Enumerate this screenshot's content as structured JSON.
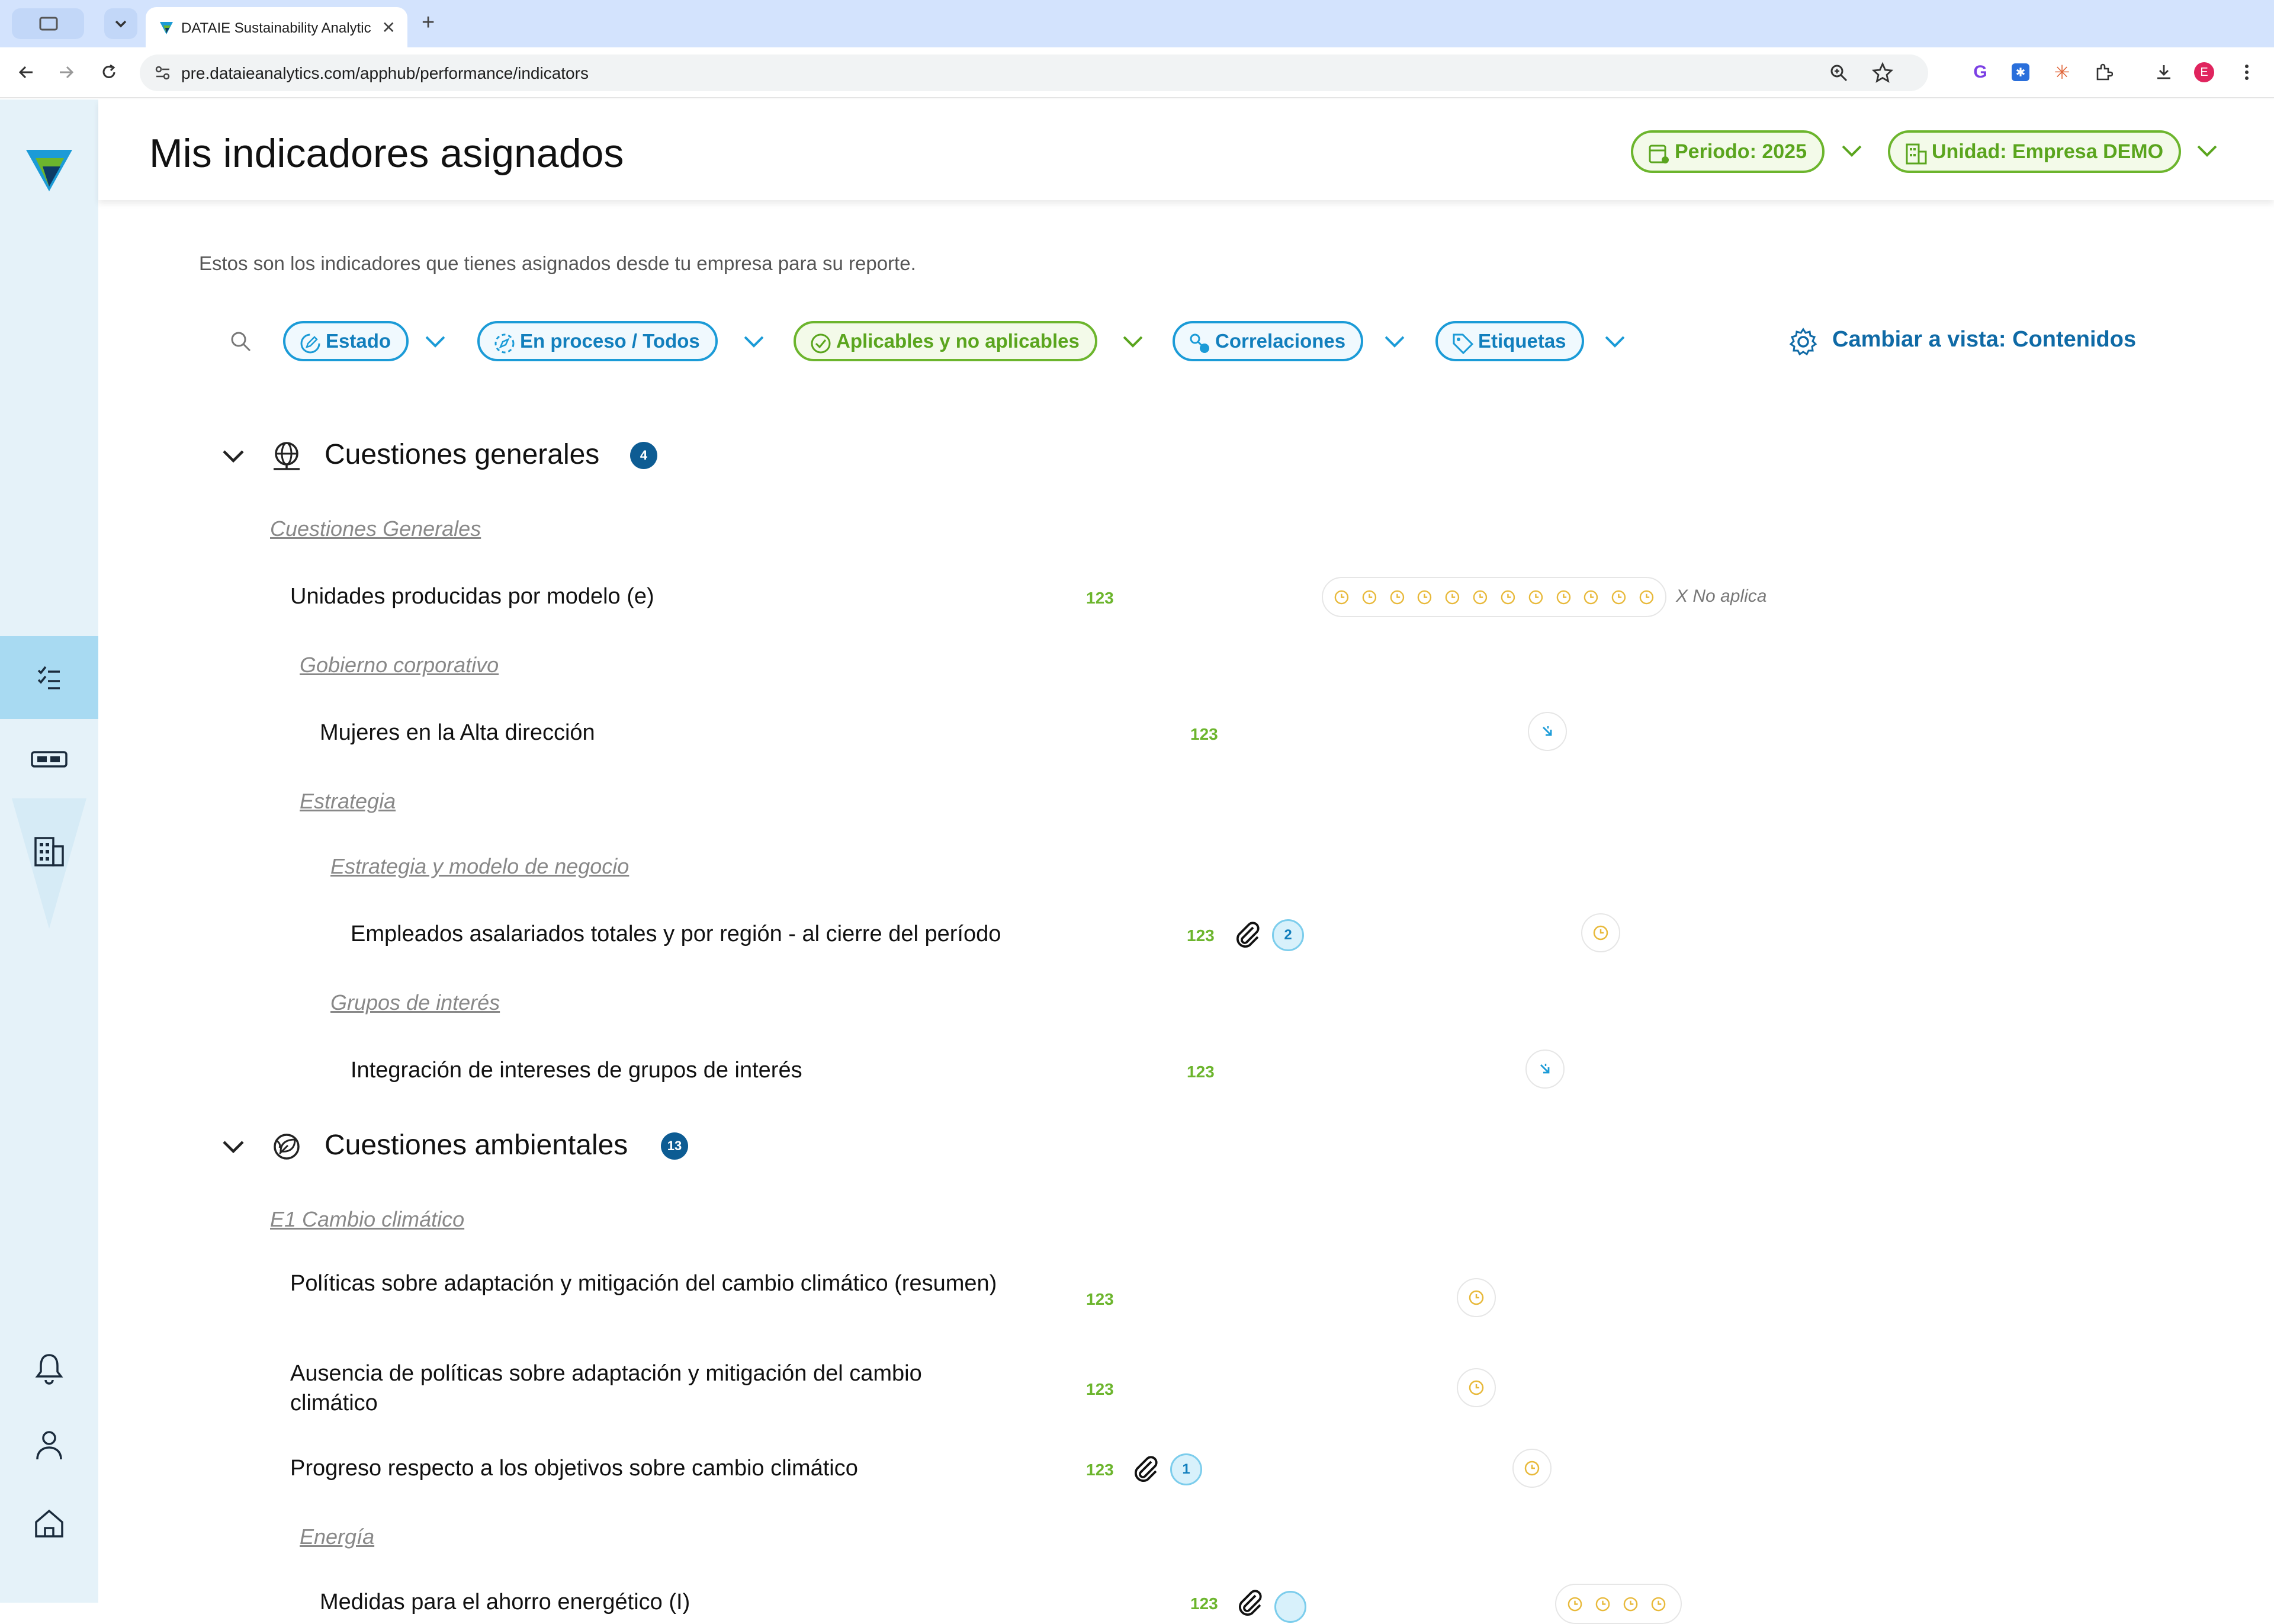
{
  "browser": {
    "tab_title": "DATAIE Sustainability Analytics",
    "url": "pre.dataieanalytics.com/apphub/performance/indicators",
    "profile_initial": "E"
  },
  "header": {
    "title": "Mis indicadores asignados",
    "period_label": "Periodo: 2025",
    "unit_label": "Unidad: Empresa DEMO"
  },
  "intro": "Estos son los indicadores que tienes asignados desde tu empresa para su reporte.",
  "filters": {
    "estado": "Estado",
    "proceso": "En proceso / Todos",
    "aplicables": "Aplicables y no aplicables",
    "correlaciones": "Correlaciones",
    "etiquetas": "Etiquetas"
  },
  "switch_view": "Cambiar a vista: Contenidos",
  "sections": {
    "generales": {
      "title": "Cuestiones generales",
      "count": "4",
      "group_generales": "Cuestiones Generales",
      "ind_unidades": "Unidades producidas por modelo (e)",
      "na_label": "X No aplica",
      "group_gobierno": "Gobierno corporativo",
      "ind_mujeres": "Mujeres en la Alta dirección",
      "group_estrategia": "Estrategia",
      "group_modelo": "Estrategia y modelo de negocio",
      "ind_empleados": "Empleados asalariados totales y por región - al cierre del período",
      "att_empleados": "2",
      "group_interes": "Grupos de interés",
      "ind_integracion": "Integración de intereses de grupos de interés"
    },
    "ambientales": {
      "title": "Cuestiones ambientales",
      "count": "13",
      "group_e1": "E1 Cambio climático",
      "ind_politicas": "Políticas sobre adaptación y mitigación del cambio climático (resumen)",
      "ind_ausencia": "Ausencia de políticas sobre adaptación y mitigación del cambio climático",
      "ind_progreso": "Progreso respecto a los objetivos sobre cambio climático",
      "att_progreso": "1",
      "group_energia": "Energía",
      "ind_medidas": "Medidas para el ahorro energético (I)"
    }
  },
  "numeric_tag": "123",
  "colors": {
    "accent_blue": "#127fbd",
    "accent_green": "#6cb52d",
    "badge_navy": "#0d5c93",
    "pending_yellow": "#e8b93a",
    "sidebar_bg": "#e5f2f9"
  }
}
